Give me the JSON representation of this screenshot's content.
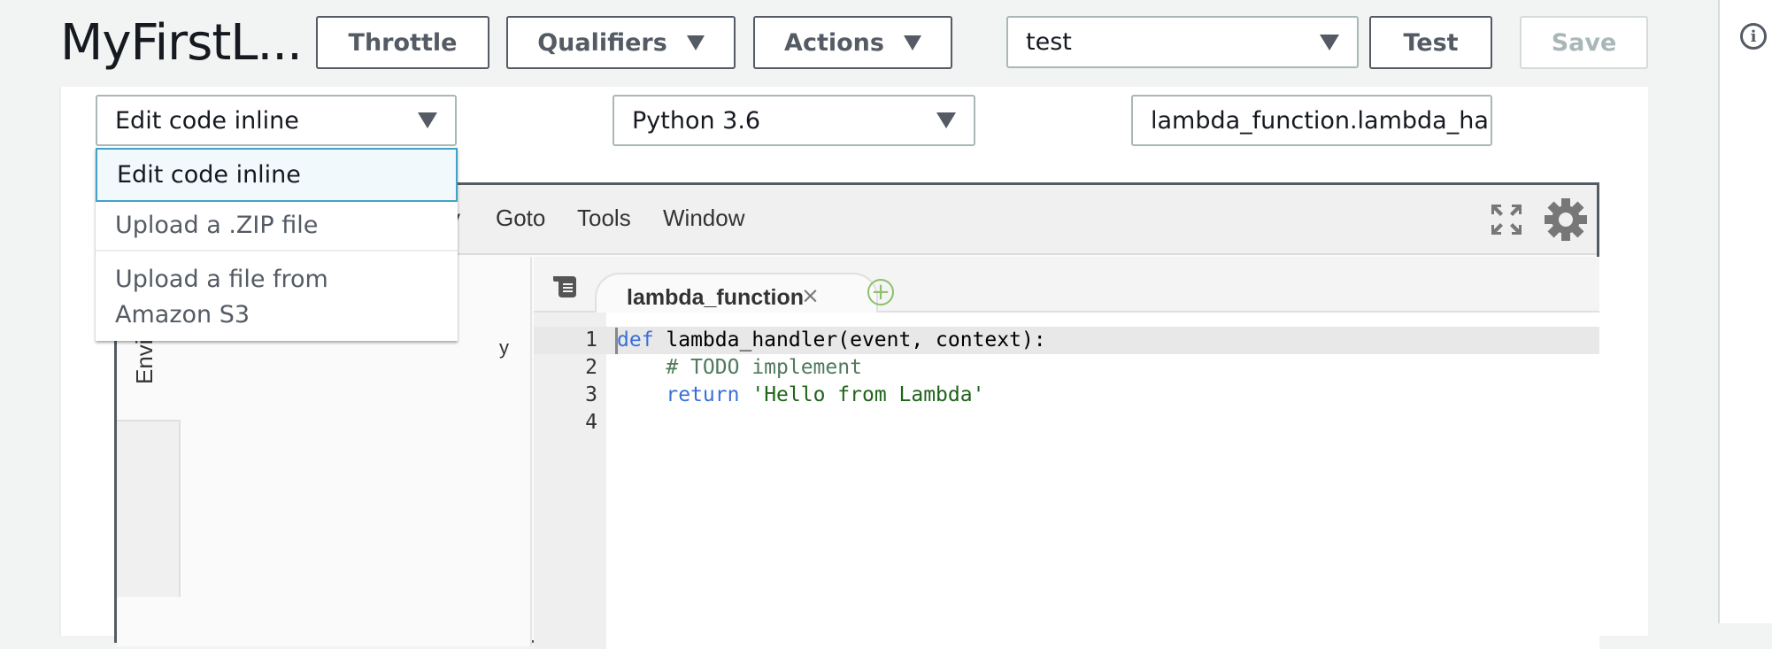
{
  "header": {
    "title": "MyFirstL...",
    "buttons": {
      "throttle": "Throttle",
      "qualifiers": "Qualifiers",
      "actions": "Actions",
      "test": "Test",
      "save": "Save"
    },
    "test_event_select": {
      "value": "test"
    }
  },
  "function_code": {
    "code_entry_type": {
      "value": "Edit code inline",
      "expanded": true
    },
    "code_entry_options": [
      "Edit code inline",
      "Upload a .ZIP file",
      "Upload a file from Amazon S3"
    ],
    "runtime": {
      "value": "Python 3.6"
    },
    "handler": {
      "value": "lambda_function.lambda_ha"
    }
  },
  "editor": {
    "menubar": {
      "partial_item": "y",
      "items": [
        "Goto",
        "Tools",
        "Window"
      ]
    },
    "environment_tab": "Envir",
    "tree_partial_file": "y",
    "open_tab": {
      "label": "lambda_function",
      "close": "×"
    },
    "add_tab": "+",
    "lines": [
      {
        "num": "1",
        "tokens": [
          {
            "t": "def",
            "c": "kw"
          },
          {
            "t": " lambda_handler(event, context):",
            "c": ""
          }
        ]
      },
      {
        "num": "2",
        "tokens": [
          {
            "t": "    ",
            "c": ""
          },
          {
            "t": "# TODO implement",
            "c": "cm"
          }
        ]
      },
      {
        "num": "3",
        "tokens": [
          {
            "t": "    ",
            "c": ""
          },
          {
            "t": "return",
            "c": "kw"
          },
          {
            "t": " ",
            "c": ""
          },
          {
            "t": "'Hello from Lambda'",
            "c": "st"
          }
        ]
      },
      {
        "num": "4",
        "tokens": []
      }
    ]
  },
  "icons": {
    "info": "i"
  },
  "colors": {
    "accent": "#44a1c7",
    "button_border": "#545b64",
    "disabled_text": "#aab7b8",
    "add_tab_green": "#8cc06a"
  }
}
